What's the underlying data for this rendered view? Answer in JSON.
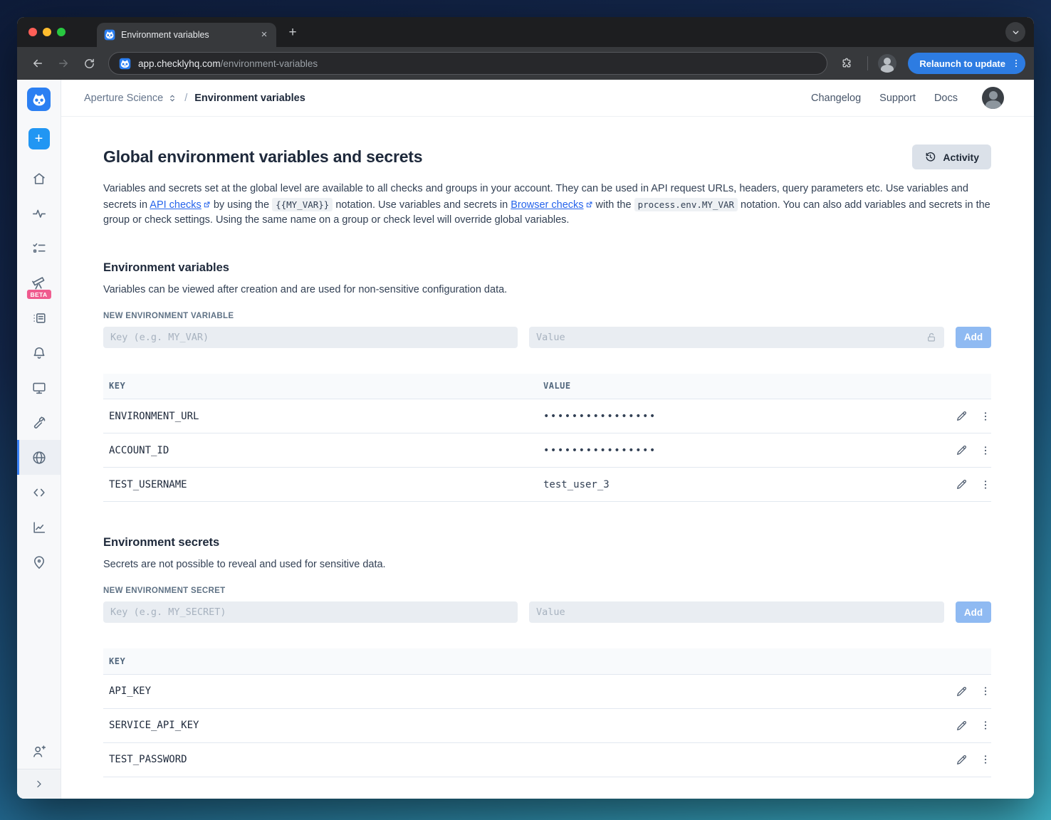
{
  "browser": {
    "tab_title": "Environment variables",
    "url_host": "app.checklyhq.com",
    "url_path": "/environment-variables",
    "relaunch_label": "Relaunch to update"
  },
  "header": {
    "breadcrumb_account": "Aperture Science",
    "breadcrumb_separator": "/",
    "breadcrumb_page": "Environment variables",
    "links": [
      "Changelog",
      "Support",
      "Docs"
    ]
  },
  "sidebar": {
    "beta_badge": "BETA",
    "icons": [
      "checkly-logo",
      "create-plus",
      "home",
      "activity-pulse",
      "checks-list",
      "telescope-beta",
      "logs",
      "alerts-bell",
      "dashboards-monitor",
      "maintenance-wrench",
      "environment-globe",
      "code-snippets",
      "analytics-chart",
      "locations-pin",
      "invite-user",
      "expand-chevron"
    ]
  },
  "main": {
    "title": "Global environment variables and secrets",
    "activity_label": "Activity",
    "intro": {
      "part1": "Variables and secrets set at the global level are available to all checks and groups in your account. They can be used in API request URLs, headers, query parameters etc. Use variables and secrets in ",
      "link1": "API checks",
      "part2": " by using the ",
      "code1": "{{MY_VAR}}",
      "part3": " notation. Use variables and secrets in ",
      "link2": "Browser checks",
      "part4": " with the ",
      "code2": "process.env.MY_VAR",
      "part5": " notation. You can also add variables and secrets in the group or check settings. Using the same name on a group or check level will override global variables."
    },
    "variables_section": {
      "heading": "Environment variables",
      "description": "Variables can be viewed after creation and are used for non-sensitive configuration data.",
      "new_label": "NEW ENVIRONMENT VARIABLE",
      "key_placeholder": "Key (e.g. MY_VAR)",
      "value_placeholder": "Value",
      "add_label": "Add",
      "table": {
        "col_key": "KEY",
        "col_value": "VALUE",
        "rows": [
          {
            "key": "ENVIRONMENT_URL",
            "value": "••••••••••••••••"
          },
          {
            "key": "ACCOUNT_ID",
            "value": "••••••••••••••••"
          },
          {
            "key": "TEST_USERNAME",
            "value": "test_user_3"
          }
        ]
      }
    },
    "secrets_section": {
      "heading": "Environment secrets",
      "description": "Secrets are not possible to reveal and used for sensitive data.",
      "new_label": "NEW ENVIRONMENT SECRET",
      "key_placeholder": "Key (e.g. MY_SECRET)",
      "value_placeholder": "Value",
      "add_label": "Add",
      "table": {
        "col_key": "KEY",
        "rows": [
          {
            "key": "API_KEY"
          },
          {
            "key": "SERVICE_API_KEY"
          },
          {
            "key": "TEST_PASSWORD"
          }
        ]
      }
    }
  },
  "colors": {
    "brand_blue": "#2b7ff2",
    "add_button_blue": "#8fbaf2",
    "beta_pink": "#ef5a8e",
    "relaunch_blue": "#2d7ce2",
    "selected_border_blue": "#3b82f6",
    "link_blue": "#2563eb"
  }
}
